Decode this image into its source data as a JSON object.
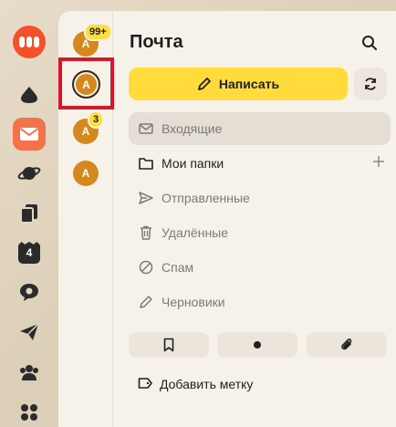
{
  "rail": {
    "calendar_badge": "4"
  },
  "accounts": [
    {
      "initial": "A",
      "badge": "99+"
    },
    {
      "initial": "A",
      "badge": ""
    },
    {
      "initial": "A",
      "badge": "3"
    },
    {
      "initial": "A",
      "badge": ""
    }
  ],
  "header": {
    "title": "Почта"
  },
  "compose": {
    "label": "Написать"
  },
  "folders": {
    "inbox": "Входящие",
    "my_folders": "Мои папки",
    "sent": "Отправленные",
    "deleted": "Удалённые",
    "spam": "Спам",
    "drafts": "Черновики"
  },
  "labels": {
    "add_label": "Добавить метку"
  },
  "colors": {
    "accent_yellow": "#ffdc3c",
    "brand_orange": "#f4512b",
    "avatar": "#d4881e",
    "selection_border": "#d6172a"
  }
}
